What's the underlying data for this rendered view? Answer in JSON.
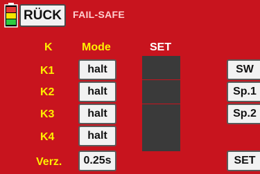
{
  "header": {
    "back_label": "RÜCK",
    "title": "FAIL-SAFE",
    "battery_colors": [
      "#e53935",
      "#f6e600",
      "#2ecc40"
    ]
  },
  "columns": {
    "k": "K",
    "mode": "Mode",
    "set": "SET"
  },
  "rows": [
    {
      "label": "K1",
      "mode": "halt"
    },
    {
      "label": "K2",
      "mode": "halt"
    },
    {
      "label": "K3",
      "mode": "halt"
    },
    {
      "label": "K4",
      "mode": "halt"
    }
  ],
  "delay": {
    "label": "Verz.",
    "value": "0.25s"
  },
  "side_buttons": {
    "sw": "SW",
    "sp1": "Sp.1",
    "sp2": "Sp.2",
    "set": "SET"
  }
}
